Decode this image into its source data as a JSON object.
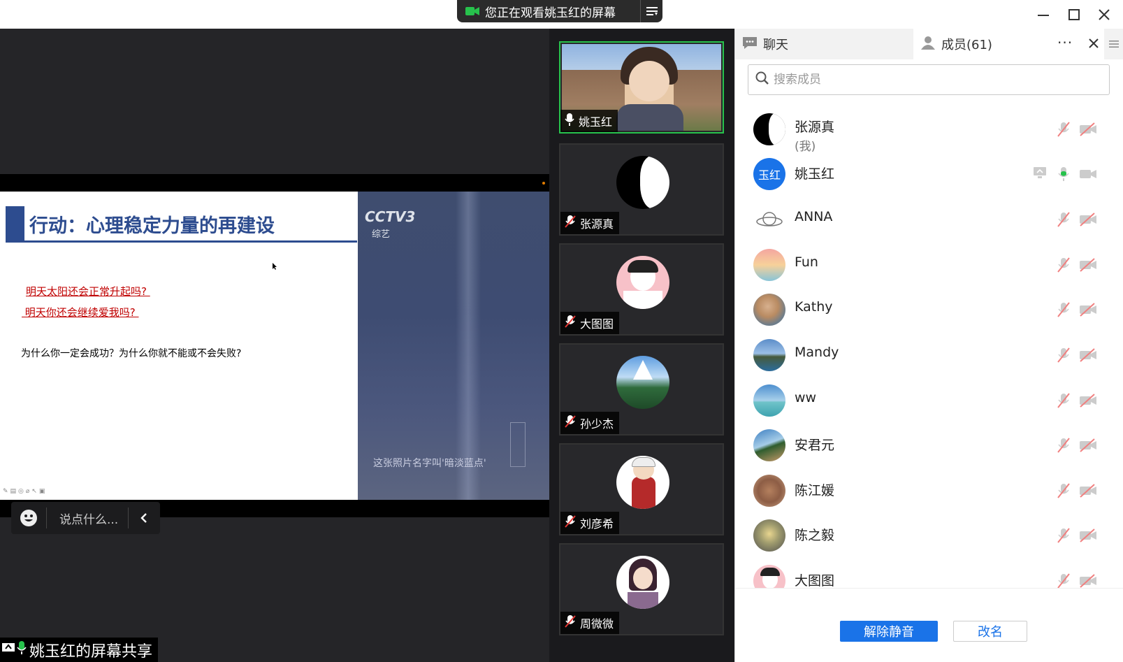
{
  "banner": {
    "text": "您正在观看姚玉红的屏幕"
  },
  "slide": {
    "title": "行动：心理稳定力量的再建设",
    "question1": "明天太阳还会正常升起吗? ",
    "question2": " 明天你还会继续爱我吗? ",
    "body": "为什么你一定会成功？为什么你就不能或不会失败?",
    "toolbar_glyphs": "✎▤◎⌀↖▣"
  },
  "video": {
    "logo": "CCTV3",
    "channel": "综艺",
    "caption": "这张照片名字叫'暗淡蓝点'"
  },
  "chat_input": {
    "placeholder": "说点什么..."
  },
  "share_label": "姚玉红的屏幕共享",
  "tiles": [
    {
      "name": "姚玉红",
      "mic": "on"
    },
    {
      "name": "张源真",
      "mic": "muted"
    },
    {
      "name": "大图图",
      "mic": "muted"
    },
    {
      "name": "孙少杰",
      "mic": "muted"
    },
    {
      "name": "刘彦希",
      "mic": "muted"
    },
    {
      "name": "周微微",
      "mic": "muted"
    }
  ],
  "panel": {
    "tab_chat": "聊天",
    "tab_members": "成员(61)",
    "search_placeholder": "搜索成员",
    "members": [
      {
        "name": "张源真",
        "sub": "(我)"
      },
      {
        "name": "姚玉红",
        "avatar_text": "玉红"
      },
      {
        "name": "ANNA"
      },
      {
        "name": "Fun"
      },
      {
        "name": "Kathy"
      },
      {
        "name": "Mandy"
      },
      {
        "name": "ww"
      },
      {
        "name": "安君元"
      },
      {
        "name": "陈江媛"
      },
      {
        "name": "陈之毅"
      },
      {
        "name": "大图图"
      }
    ],
    "btn_unmute": "解除静音",
    "btn_rename": "改名"
  },
  "colors": {
    "accent": "#1a73e8",
    "active_border": "#27c24c",
    "slide_blue": "#2d4c8f",
    "slide_red": "#c00000"
  }
}
